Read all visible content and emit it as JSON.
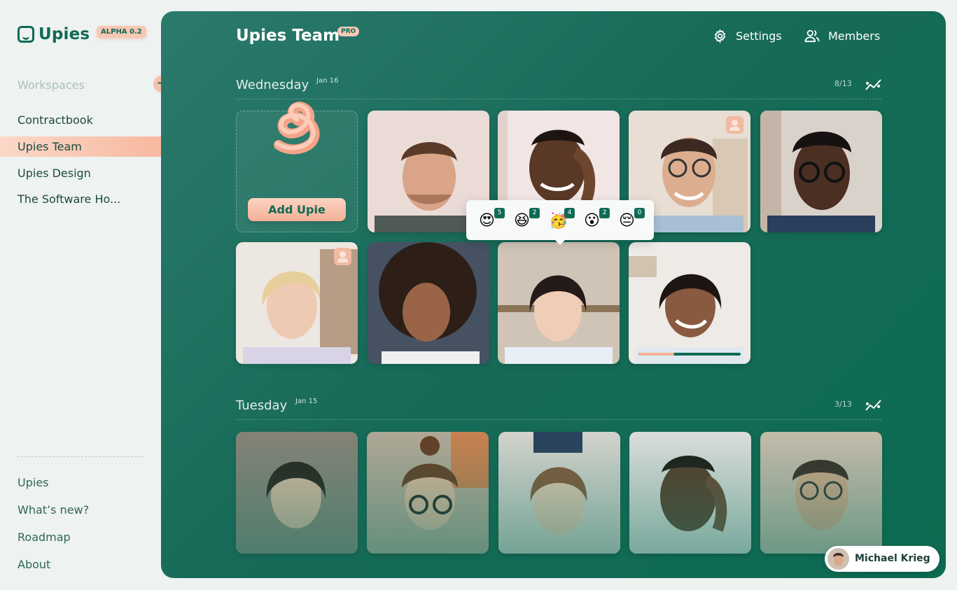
{
  "app": {
    "name": "Upies",
    "version_badge": "ALPHA 0.2"
  },
  "sidebar": {
    "workspaces_label": "Workspaces",
    "items": [
      {
        "label": "Contractbook",
        "active": false
      },
      {
        "label": "Upies Team",
        "active": true
      },
      {
        "label": "Upies Design",
        "active": false
      },
      {
        "label": "The Software Ho...",
        "active": false
      }
    ],
    "footer_links": [
      "Upies",
      "What’s new?",
      "Roadmap",
      "About"
    ]
  },
  "header": {
    "title": "Upies Team",
    "plan_badge": "PRO",
    "settings_label": "Settings",
    "members_label": "Members"
  },
  "days": [
    {
      "name": "Wednesday",
      "date": "Jan 16",
      "count": "8/13",
      "add_label": "Add Upie"
    },
    {
      "name": "Tuesday",
      "date": "Jan 15",
      "count": "3/13"
    }
  ],
  "reactions": [
    {
      "emoji": "😍",
      "count": "5"
    },
    {
      "emoji": "😆",
      "count": "2"
    },
    {
      "emoji": "🥳",
      "count": "4"
    },
    {
      "emoji": "😮",
      "count": "2"
    },
    {
      "emoji": "😔",
      "count": "0"
    }
  ],
  "playback_progress": 0.35,
  "current_user": {
    "name": "Michael Krieg"
  },
  "colors": {
    "brand": "#0f6a55",
    "accent": "#f4b096"
  }
}
